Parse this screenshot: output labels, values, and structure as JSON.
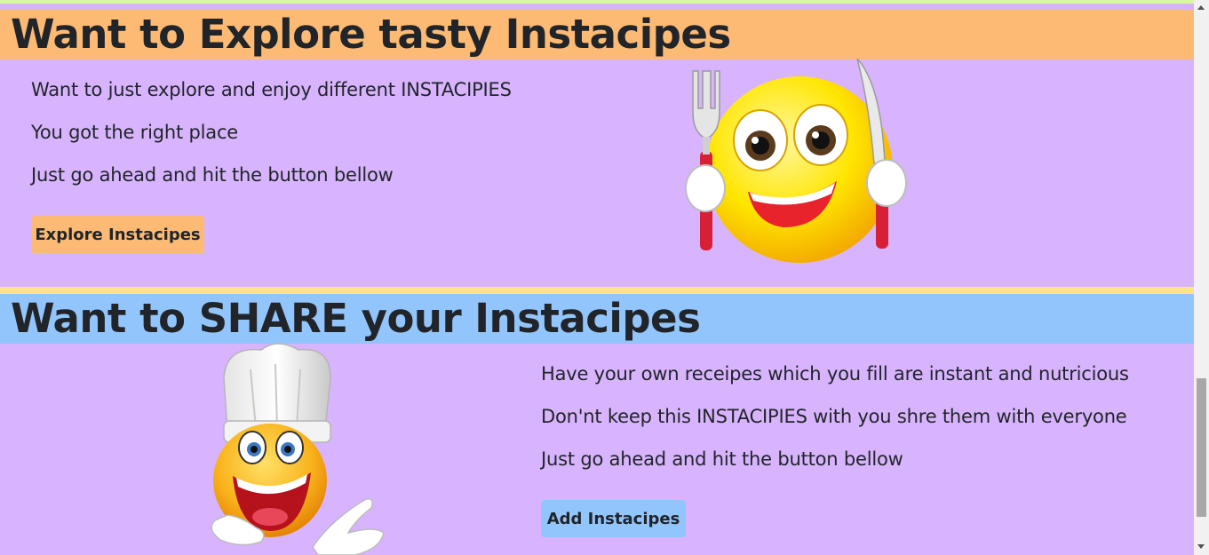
{
  "explore": {
    "heading": "Want to Explore tasty Instacipes",
    "lines": [
      "Want to just explore and enjoy different INSTACIPIES",
      "You got the right place",
      "Just go ahead and hit the button bellow"
    ],
    "button_label": "Explore Instacipes",
    "image_icon": "hungry-emoji-fork-knife-icon"
  },
  "share": {
    "heading": "Want to SHARE your Instacipes",
    "lines": [
      "Have your own receipes which you fill are instant and nutricious",
      "Don'nt keep this INSTACIPIES with you shre them with everyone",
      "Just go ahead and hit the button bellow"
    ],
    "button_label": "Add Instacipes",
    "image_icon": "chef-emoji-icon"
  },
  "colors": {
    "page_background": "#d8b4fe",
    "explore_accent": "#fdba74",
    "share_accent": "#93c5fd",
    "separator": "#fde68a"
  }
}
